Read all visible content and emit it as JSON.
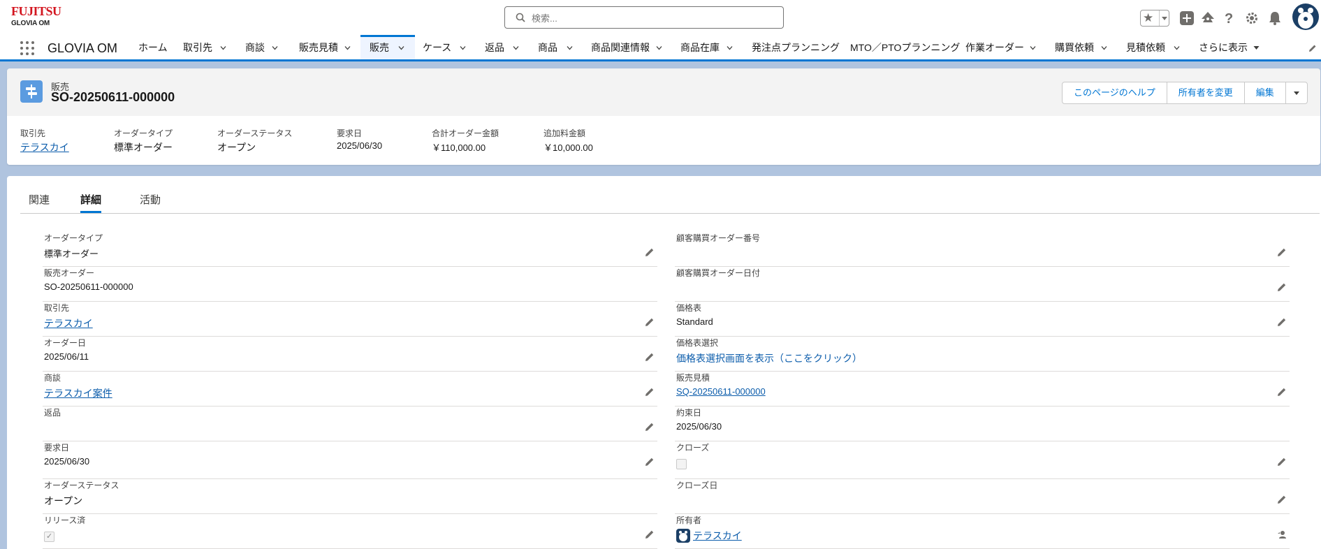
{
  "logo": {
    "brand": "FUJITSU",
    "product": "GLOVIA OM"
  },
  "search": {
    "placeholder": "検索..."
  },
  "nav": {
    "app_name": "GLOVIA OM",
    "items": [
      {
        "label": "ホーム"
      },
      {
        "label": "取引先"
      },
      {
        "label": "商談"
      },
      {
        "label": "販売見積"
      },
      {
        "label": "販売"
      },
      {
        "label": "ケース"
      },
      {
        "label": "返品"
      },
      {
        "label": "商品"
      },
      {
        "label": "商品関連情報"
      },
      {
        "label": "商品在庫"
      },
      {
        "label": "発注点プランニング"
      },
      {
        "label": "MTO／PTOプランニング"
      },
      {
        "label": "作業オーダー"
      },
      {
        "label": "購買依頼"
      },
      {
        "label": "見積依頼"
      },
      {
        "label": "さらに表示"
      }
    ],
    "active": "販売"
  },
  "record": {
    "object_label": "販売",
    "title": "SO-20250611-000000",
    "buttons": [
      "このページのヘルプ",
      "所有者を変更",
      "編集"
    ],
    "highlights": [
      {
        "label": "取引先",
        "value": "テラスカイ"
      },
      {
        "label": "オーダータイプ",
        "value": "標準オーダー"
      },
      {
        "label": "オーダーステータス",
        "value": "オープン"
      },
      {
        "label": "要求日",
        "value": "2025/06/30"
      },
      {
        "label": "合計オーダー金額",
        "value": "￥110,000.00"
      },
      {
        "label": "追加料金額",
        "value": "￥10,000.00"
      }
    ]
  },
  "tabs": [
    "関連",
    "詳細",
    "活動"
  ],
  "active_tab": "詳細",
  "fields_left": [
    {
      "label": "オーダータイプ",
      "value": "標準オーダー"
    },
    {
      "label": "販売オーダー",
      "value": "SO-20250611-000000"
    },
    {
      "label": "取引先",
      "value": "テラスカイ"
    },
    {
      "label": "オーダー日",
      "value": "2025/06/11"
    },
    {
      "label": "商談",
      "value": "テラスカイ案件"
    },
    {
      "label": "返品",
      "value": ""
    },
    {
      "label": "要求日",
      "value": "2025/06/30"
    },
    {
      "label": "オーダーステータス",
      "value": "オープン"
    },
    {
      "label": "リリース済",
      "value": "checked"
    }
  ],
  "fields_right": [
    {
      "label": "顧客購買オーダー番号",
      "value": ""
    },
    {
      "label": "顧客購買オーダー日付",
      "value": ""
    },
    {
      "label": "価格表",
      "value": "Standard"
    },
    {
      "label": "価格表選択",
      "value": "価格表選択画面を表示（ここをクリック）"
    },
    {
      "label": "販売見積",
      "value": "SQ-20250611-000000"
    },
    {
      "label": "約束日",
      "value": "2025/06/30"
    },
    {
      "label": "クローズ",
      "value": "unchecked"
    },
    {
      "label": "クローズ日",
      "value": ""
    },
    {
      "label": "所有者",
      "value": "テラスカイ"
    }
  ],
  "colors": {
    "brand_blue": "#0176d3",
    "link": "#0b5cab",
    "fujitsu_red": "#d3151f"
  }
}
